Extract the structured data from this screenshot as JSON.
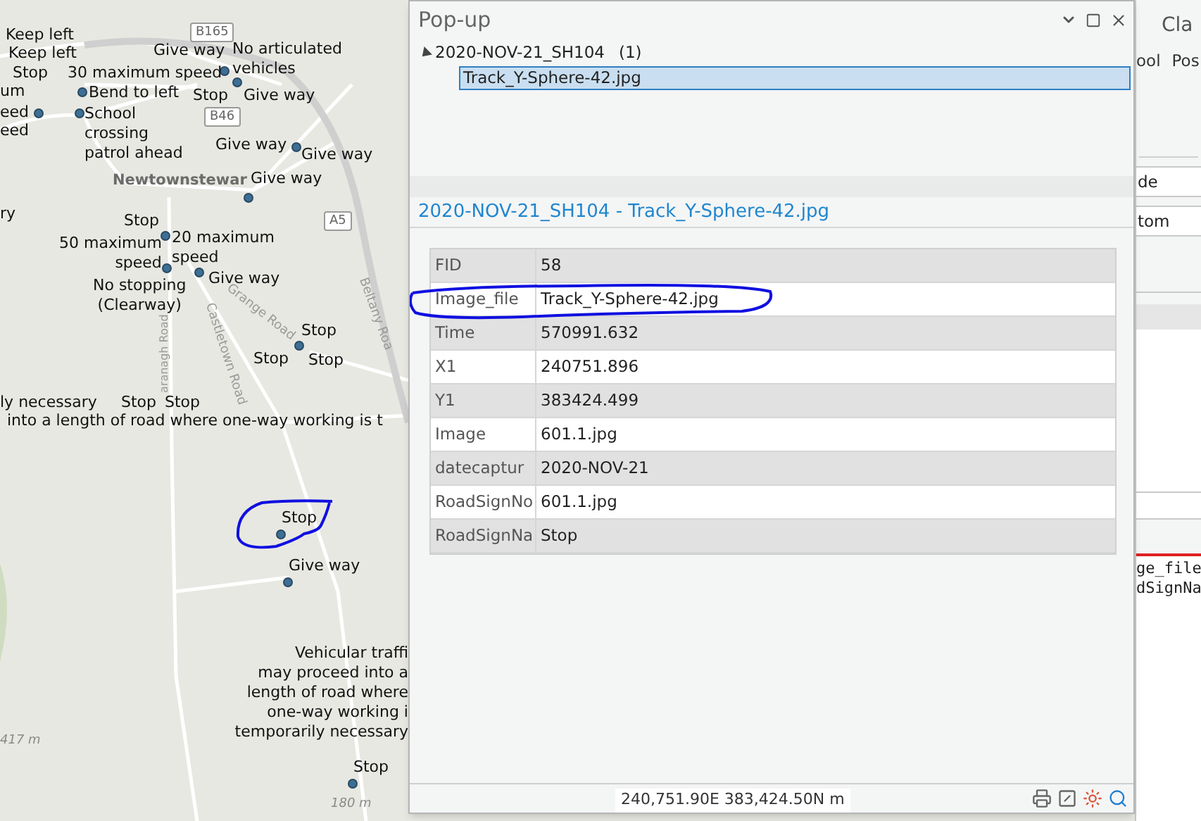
{
  "map": {
    "labels": [
      {
        "kind": "sign",
        "lines": [
          "Keep left"
        ]
      },
      {
        "kind": "sign",
        "lines": [
          "Keep left"
        ]
      },
      {
        "kind": "sign",
        "lines": [
          "Stop"
        ]
      },
      {
        "kind": "sign",
        "lines": [
          "um"
        ]
      },
      {
        "kind": "sign",
        "lines": [
          "eed"
        ]
      },
      {
        "kind": "sign",
        "lines": [
          "eed"
        ]
      },
      {
        "kind": "sign",
        "lines": [
          "30 maximum speed"
        ]
      },
      {
        "kind": "sign",
        "lines": [
          "Bend to left"
        ]
      },
      {
        "kind": "sign",
        "lines": [
          "School",
          "crossing",
          "patrol ahead"
        ]
      },
      {
        "kind": "shield",
        "lines": [
          "B165"
        ]
      },
      {
        "kind": "sign",
        "lines": [
          "Give way"
        ]
      },
      {
        "kind": "sign",
        "lines": [
          "No articulated",
          "vehicles"
        ]
      },
      {
        "kind": "shield",
        "lines": [
          "B46"
        ]
      },
      {
        "kind": "sign",
        "lines": [
          "Stop"
        ]
      },
      {
        "kind": "sign",
        "lines": [
          "Give way"
        ]
      },
      {
        "kind": "sign",
        "lines": [
          "Give way"
        ]
      },
      {
        "kind": "sign",
        "lines": [
          "Give way"
        ]
      },
      {
        "kind": "place",
        "lines": [
          "Newtownstewar"
        ]
      },
      {
        "kind": "sign",
        "lines": [
          "Give way"
        ]
      },
      {
        "kind": "sign",
        "lines": [
          "ry"
        ]
      },
      {
        "kind": "sign",
        "lines": [
          "Stop"
        ]
      },
      {
        "kind": "shield",
        "lines": [
          "A5"
        ]
      },
      {
        "kind": "sign",
        "lines": [
          "50 maximum",
          "speed"
        ]
      },
      {
        "kind": "sign",
        "lines": [
          "20 maximum",
          "speed"
        ]
      },
      {
        "kind": "sign",
        "lines": [
          "Give way"
        ]
      },
      {
        "kind": "sign",
        "lines": [
          "No stopping",
          "(Clearway)"
        ]
      },
      {
        "kind": "road",
        "lines": [
          "Beltany Roa"
        ]
      },
      {
        "kind": "road",
        "lines": [
          "Grange Road"
        ]
      },
      {
        "kind": "road",
        "lines": [
          "Castletown Road"
        ]
      },
      {
        "kind": "road",
        "lines": [
          "aranagh Road"
        ]
      },
      {
        "kind": "sign",
        "lines": [
          "Stop"
        ]
      },
      {
        "kind": "sign",
        "lines": [
          "Stop"
        ]
      },
      {
        "kind": "sign",
        "lines": [
          "Stop"
        ]
      },
      {
        "kind": "sign",
        "lines": [
          "ly necessary"
        ]
      },
      {
        "kind": "sign",
        "lines": [
          "Stop"
        ]
      },
      {
        "kind": "sign",
        "lines": [
          "Stop"
        ]
      },
      {
        "kind": "sign",
        "lines": [
          "into a length of road where one-way working is t"
        ]
      },
      {
        "kind": "sign",
        "lines": [
          "Stop"
        ]
      },
      {
        "kind": "sign",
        "lines": [
          "Give way"
        ]
      },
      {
        "kind": "elevation",
        "lines": [
          "417 m"
        ]
      },
      {
        "kind": "sign",
        "lines": [
          "Vehicular traffi",
          "may proceed into a",
          "length of road where",
          "one-way working i",
          "temporarily necessary"
        ]
      },
      {
        "kind": "sign",
        "lines": [
          "Stop"
        ]
      },
      {
        "kind": "elevation",
        "lines": [
          "180 m"
        ]
      }
    ]
  },
  "popup": {
    "title": "Pop-up",
    "tree": [
      {
        "label": "2020-NOV-21_SH104",
        "count": "(1)",
        "expanded": true,
        "children": [
          {
            "label": "Track_Y-Sphere-42.jpg",
            "selected": true
          }
        ]
      }
    ],
    "heading": "2020-NOV-21_SH104 - Track_Y-Sphere-42.jpg",
    "fields": [
      {
        "name": "FID",
        "value": "58"
      },
      {
        "name": "Image_file",
        "value": "Track_Y-Sphere-42.jpg"
      },
      {
        "name": "Time",
        "value": "570991.632"
      },
      {
        "name": "X1",
        "value": "240751.896"
      },
      {
        "name": "Y1",
        "value": "383424.499"
      },
      {
        "name": "Image",
        "value": "601.1.jpg"
      },
      {
        "name": "datecaptur",
        "value": "2020-NOV-21"
      },
      {
        "name": "RoadSignNo",
        "value": "601.1.jpg"
      },
      {
        "name": "RoadSignNa",
        "value": "Stop"
      }
    ]
  },
  "status_bar": {
    "coordinates": "240,751.90E 383,424.50N m"
  },
  "side_pane": {
    "title": "Cla",
    "tabs": [
      "ool",
      "Pos"
    ],
    "fields": [
      "de",
      "tom"
    ],
    "code_lines": [
      "ge_file",
      "dSignNa"
    ]
  }
}
